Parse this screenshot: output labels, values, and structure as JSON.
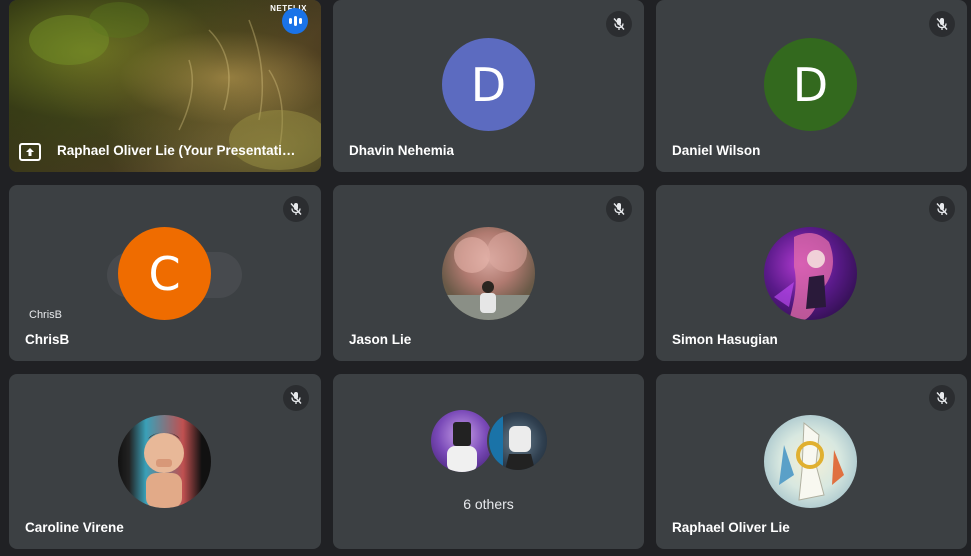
{
  "tiles": [
    {
      "name": "Raphael Oliver Lie (Your Presentation)",
      "type": "presentation",
      "brand_text": "NETFLIX"
    },
    {
      "name": "Dhavin Nehemia",
      "avatar_letter": "D",
      "avatar_color": "#5c6bc0",
      "muted": true
    },
    {
      "name": "Daniel Wilson",
      "avatar_letter": "D",
      "avatar_color": "#33691e",
      "muted": true
    },
    {
      "name": "ChrisB",
      "avatar_letter": "C",
      "avatar_color": "#ef6c00",
      "self_label": "ChrisB",
      "muted": true
    },
    {
      "name": "Jason Lie",
      "avatar": "photo",
      "muted": true
    },
    {
      "name": "Simon Hasugian",
      "avatar": "photo",
      "muted": true
    },
    {
      "name": "Caroline Virene",
      "avatar": "photo",
      "muted": true
    },
    {
      "others_label": "6 others"
    },
    {
      "name": "Raphael Oliver Lie",
      "avatar": "photo",
      "muted": true
    }
  ],
  "icons": {
    "mute": "mic-off-icon",
    "present": "present-to-all-icon",
    "speaking": "speaking-indicator-icon"
  },
  "colors": {
    "background": "#202124",
    "tile": "#3c4043",
    "accent": "#1a73e8"
  }
}
